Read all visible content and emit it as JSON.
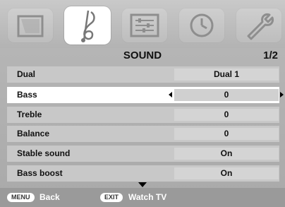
{
  "tabs": [
    {
      "name": "picture",
      "icon": "picture-icon"
    },
    {
      "name": "sound",
      "icon": "music-note-icon",
      "selected": true
    },
    {
      "name": "setup",
      "icon": "sliders-icon"
    },
    {
      "name": "timer",
      "icon": "clock-icon"
    },
    {
      "name": "settings",
      "icon": "wrench-icon"
    }
  ],
  "menu": {
    "title": "SOUND",
    "page": "1/2"
  },
  "rows": [
    {
      "label": "Dual",
      "value": "Dual 1"
    },
    {
      "label": "Bass",
      "value": "0",
      "active": true
    },
    {
      "label": "Treble",
      "value": "0"
    },
    {
      "label": "Balance",
      "value": "0"
    },
    {
      "label": "Stable sound",
      "value": "On"
    },
    {
      "label": "Bass boost",
      "value": "On"
    }
  ],
  "footer": {
    "menu_key": "MENU",
    "menu_label": "Back",
    "exit_key": "EXIT",
    "exit_label": "Watch TV"
  }
}
